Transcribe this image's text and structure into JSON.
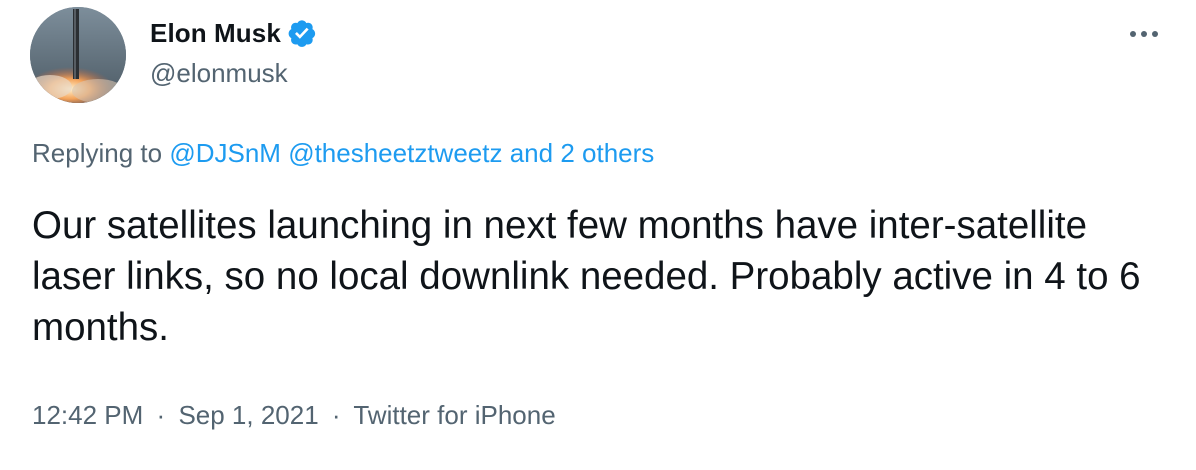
{
  "author": {
    "display_name": "Elon Musk",
    "handle": "@elonmusk",
    "verified": true,
    "verified_color": "#1d9bf0"
  },
  "reply": {
    "prefix": "Replying to",
    "mentions": [
      "@DJSnM",
      "@thesheetztweetz"
    ],
    "others": "and 2 others"
  },
  "tweet": {
    "text": "Our satellites launching in next few months have inter-satellite laser links, so no local downlink needed. Probably active in 4 to 6 months."
  },
  "meta": {
    "time": "12:42 PM",
    "date": "Sep 1, 2021",
    "source": "Twitter for iPhone",
    "separator": "·"
  },
  "icons": {
    "more": "more-horizontal-icon",
    "verified": "verified-badge-icon"
  },
  "colors": {
    "link": "#1d9bf0",
    "secondary_text": "#536471",
    "primary_text": "#0f1419"
  }
}
